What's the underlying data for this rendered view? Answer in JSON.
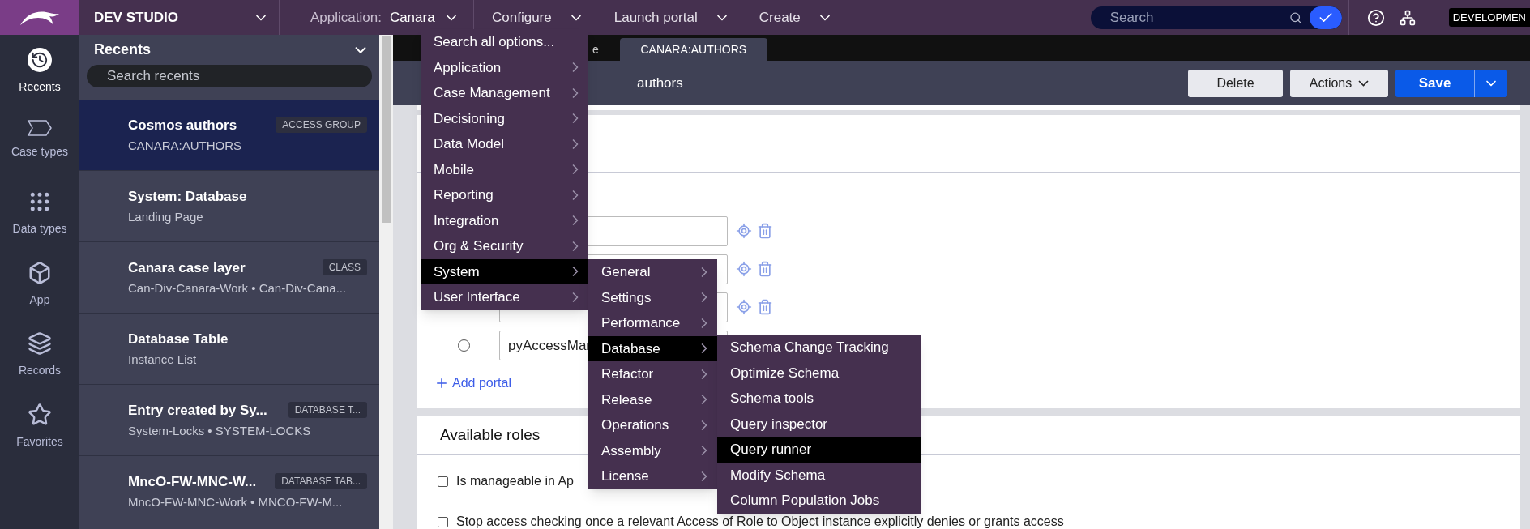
{
  "top_bar": {
    "studio": "DEV STUDIO",
    "application_label": "Application:",
    "application_value": "Canara",
    "menus": [
      "Configure",
      "Launch portal",
      "Create"
    ],
    "search": {
      "placeholder": "Search"
    },
    "environment": "DEVELOPMEN"
  },
  "rail": [
    {
      "label": "Recents",
      "selected": true,
      "kind": "recents"
    },
    {
      "label": "Case types",
      "selected": false,
      "kind": "case"
    },
    {
      "label": "Data types",
      "selected": false,
      "kind": "data"
    },
    {
      "label": "App",
      "selected": false,
      "kind": "app"
    },
    {
      "label": "Records",
      "selected": false,
      "kind": "records"
    },
    {
      "label": "Favorites",
      "selected": false,
      "kind": "favorites"
    }
  ],
  "recents": {
    "title": "Recents",
    "search": {
      "placeholder": "Search recents"
    },
    "items": [
      {
        "title": "Cosmos authors",
        "subtitle": "CANARA:AUTHORS",
        "badge": "ACCESS GROUP",
        "selected": true
      },
      {
        "title": "System: Database",
        "subtitle": "Landing Page",
        "selected": false
      },
      {
        "title": "Canara case layer",
        "subtitle": "Can-Div-Canara-Work • Can-Div-Cana...",
        "badge": "CLASS",
        "selected": false
      },
      {
        "title": "Database Table",
        "subtitle": "Instance List",
        "selected": false
      },
      {
        "title": "Entry created by Sy...",
        "subtitle": "System-Locks • SYSTEM-LOCKS",
        "badge": "DATABASE T...",
        "selected": false
      },
      {
        "title": "MncO-FW-MNC-W...",
        "subtitle": "MncO-FW-MNC-Work • MNCO-FW-M...",
        "badge": "DATABASE TAB...",
        "selected": false
      }
    ]
  },
  "tabs": [
    {
      "label": "e",
      "selected": false
    },
    {
      "label": "CANARA:AUTHORS",
      "selected": true
    }
  ],
  "header": {
    "title": "authors",
    "buttons": {
      "delete": "Delete",
      "actions": "Actions",
      "save": "Save"
    }
  },
  "portals": {
    "rows": [
      {
        "actions": true
      },
      {
        "actions": true
      },
      {
        "actions": true
      },
      {
        "value": "pyAccessMar",
        "selected": false,
        "actions": false
      }
    ],
    "add": "Add portal"
  },
  "roles": {
    "title": "Available roles",
    "options": [
      {
        "label": "Is manageable in Ap",
        "checked": false
      },
      {
        "label": "Stop access checking once a relevant Access of Role to Object instance explicitly denies or grants access",
        "checked": false
      }
    ]
  },
  "configure_menu": [
    {
      "label": "Search all options...",
      "submenu": false,
      "selected": false
    },
    {
      "label": "Application",
      "submenu": true,
      "selected": false
    },
    {
      "label": "Case Management",
      "submenu": true,
      "selected": false
    },
    {
      "label": "Decisioning",
      "submenu": true,
      "selected": false
    },
    {
      "label": "Data Model",
      "submenu": true,
      "selected": false
    },
    {
      "label": "Mobile",
      "submenu": true,
      "selected": false
    },
    {
      "label": "Reporting",
      "submenu": true,
      "selected": false
    },
    {
      "label": "Integration",
      "submenu": true,
      "selected": false
    },
    {
      "label": "Org & Security",
      "submenu": true,
      "selected": false
    },
    {
      "label": "System",
      "submenu": true,
      "selected": true
    },
    {
      "label": "User Interface",
      "submenu": true,
      "selected": false
    }
  ],
  "system_menu": [
    {
      "label": "General",
      "submenu": true,
      "selected": false
    },
    {
      "label": "Settings",
      "submenu": true,
      "selected": false
    },
    {
      "label": "Performance",
      "submenu": true,
      "selected": false
    },
    {
      "label": "Database",
      "submenu": true,
      "selected": true
    },
    {
      "label": "Refactor",
      "submenu": true,
      "selected": false
    },
    {
      "label": "Release",
      "submenu": true,
      "selected": false
    },
    {
      "label": "Operations",
      "submenu": true,
      "selected": false
    },
    {
      "label": "Assembly",
      "submenu": true,
      "selected": false
    },
    {
      "label": "License",
      "submenu": true,
      "selected": false
    }
  ],
  "database_menu": [
    {
      "label": "Schema Change Tracking",
      "submenu": false,
      "selected": false
    },
    {
      "label": "Optimize Schema",
      "submenu": false,
      "selected": false
    },
    {
      "label": "Schema tools",
      "submenu": false,
      "selected": false
    },
    {
      "label": "Query inspector",
      "submenu": false,
      "selected": false
    },
    {
      "label": "Query runner",
      "submenu": false,
      "selected": true
    },
    {
      "label": "Modify Schema",
      "submenu": false,
      "selected": false
    },
    {
      "label": "Column Population Jobs",
      "submenu": false,
      "selected": false
    }
  ]
}
